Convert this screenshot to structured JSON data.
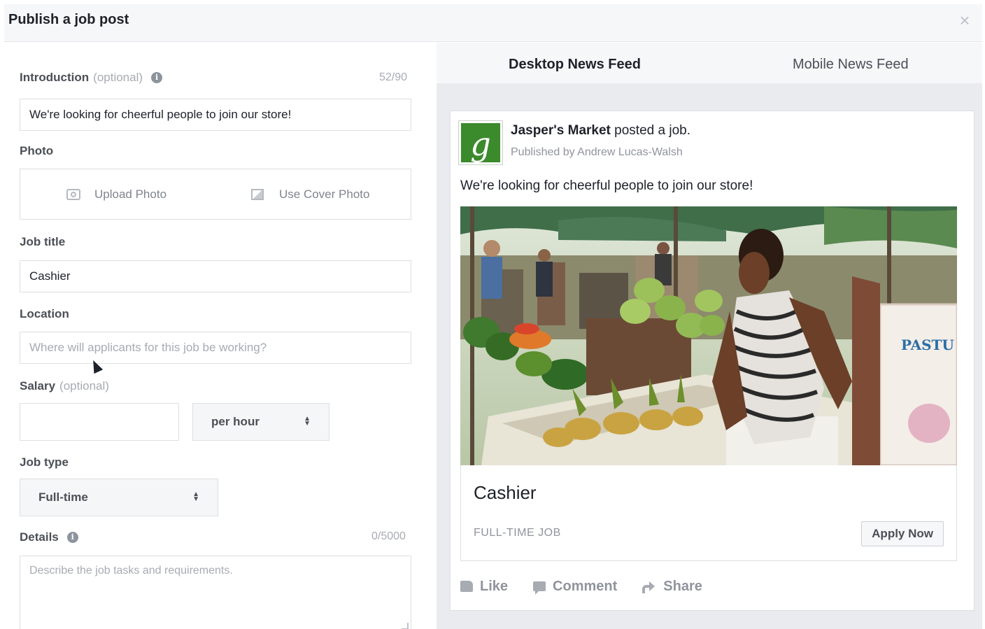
{
  "dialog": {
    "title": "Publish a job post",
    "close_icon": "close-icon"
  },
  "form": {
    "introduction": {
      "label": "Introduction",
      "optional": "(optional)",
      "counter": "52/90",
      "value": "We're looking for cheerful people to join our store!"
    },
    "photo": {
      "label": "Photo",
      "upload_label": "Upload Photo",
      "cover_label": "Use Cover Photo"
    },
    "job_title": {
      "label": "Job title",
      "value": "Cashier"
    },
    "location": {
      "label": "Location",
      "placeholder": "Where will applicants for this job be working?"
    },
    "salary": {
      "label": "Salary",
      "optional": "(optional)",
      "value": "",
      "period": "per hour"
    },
    "job_type": {
      "label": "Job type",
      "selected": "Full-time"
    },
    "details": {
      "label": "Details",
      "counter": "0/5000",
      "placeholder": "Describe the job tasks and requirements."
    }
  },
  "preview": {
    "tabs": [
      {
        "label": "Desktop News Feed",
        "active": true
      },
      {
        "label": "Mobile News Feed",
        "active": false
      }
    ],
    "post": {
      "page_name": "Jasper's Market",
      "action_text": "posted a job.",
      "published_by": "Published by Andrew Lucas-Walsh",
      "text": "We're looking for cheerful people to join our store!",
      "logo_letter": "g",
      "photo_sign_text": "PASTU",
      "job_title": "Cashier",
      "job_type": "FULL-TIME JOB",
      "apply_label": "Apply Now",
      "actions": {
        "like": "Like",
        "comment": "Comment",
        "share": "Share"
      }
    }
  },
  "colors": {
    "header_bg": "#f6f7f9",
    "preview_bg": "#e9ebee",
    "logo_green": "#3b8a2c",
    "border": "#dddfe2"
  }
}
